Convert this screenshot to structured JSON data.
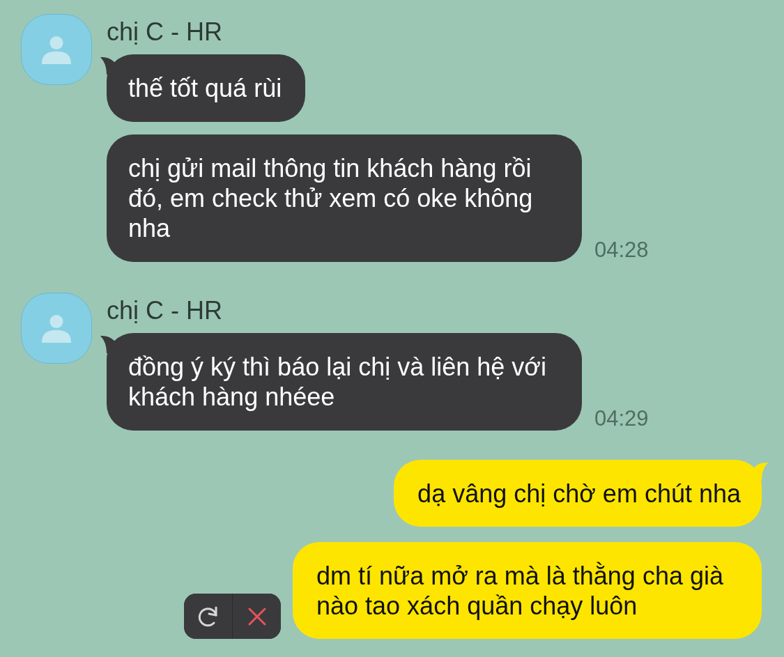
{
  "messages": [
    {
      "kind": "incoming",
      "sender": "chị C - HR",
      "bubbles": [
        {
          "text": "thế tốt quá rùi"
        },
        {
          "text": "chị gửi mail thông tin khách hàng rồi đó, em check thử xem có oke không nha"
        }
      ],
      "time": "04:28"
    },
    {
      "kind": "incoming",
      "sender": "chị C - HR",
      "bubbles": [
        {
          "text": "đồng ý ký thì báo lại chị và liên hệ với khách hàng nhéee"
        }
      ],
      "time": "04:29"
    },
    {
      "kind": "outgoing",
      "bubbles": [
        {
          "text": "dạ vâng chị chờ em chút nha",
          "failed": false
        },
        {
          "text": "dm tí nữa mở ra mà là thằng cha già nào tao xách quần chạy luôn",
          "failed": true
        }
      ]
    }
  ]
}
